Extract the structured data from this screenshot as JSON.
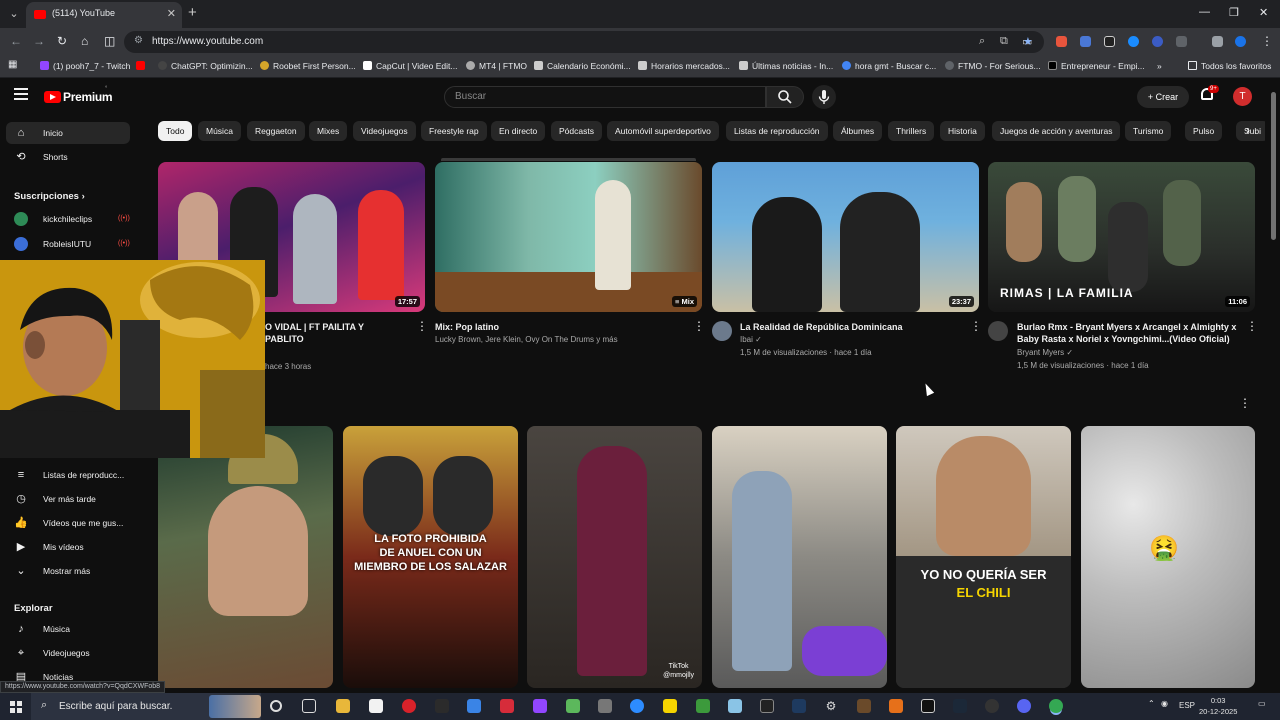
{
  "browser": {
    "tab_title": "(5114) YouTube",
    "url": "https://www.youtube.com",
    "status_url": "https://www.youtube.com/watch?v=QqdCXWFob8",
    "bookmarks": [
      "(1) pooh7_7 - Twitch",
      "ChatGPT: Optimizin...",
      "Roobet First Person...",
      "CapCut | Video Edit...",
      "MT4 | FTMO",
      "Calendario Económi...",
      "Horarios mercados...",
      "Últimas noticias - In...",
      "hora gmt - Buscar c...",
      "FTMO - For Serious...",
      "Entrepreneur - Empi..."
    ],
    "all_bookmarks": "Todos los favoritos"
  },
  "youtube": {
    "logo_text": "Premium",
    "search_placeholder": "Buscar",
    "create_label": "Crear",
    "notif_badge": "9+",
    "avatar_letter": "T",
    "chips": [
      "Todo",
      "Música",
      "Reggaeton",
      "Mixes",
      "Videojuegos",
      "Freestyle rap",
      "En directo",
      "Pódcasts",
      "Automóvil superdeportivo",
      "Listas de reproducción",
      "Álbumes",
      "Thrillers",
      "Historia",
      "Juegos de acción y aventuras",
      "Turismo",
      "Pulso",
      "Subi"
    ],
    "sidebar": {
      "home": "Inicio",
      "shorts": "Shorts",
      "subscriptions_heading": "Suscripciones",
      "subscriptions": [
        "kickchileclips",
        "RobleisIUTU"
      ],
      "you_items": [
        "Listas de reproducc...",
        "Ver más tarde",
        "Vídeos que me gus...",
        "Mis vídeos",
        "Mostrar más"
      ],
      "explore_heading": "Explorar",
      "explore_items": [
        "Música",
        "Videojuegos",
        "Noticias"
      ]
    },
    "videos": [
      {
        "title": "O VIDAL | FT PAILITA Y PABLITO",
        "meta": "hace 3 horas",
        "duration": "17:57",
        "thumb_text": ""
      },
      {
        "title": "Mix: Pop latino",
        "channel": "Lucky Brown, Jere Klein, Ovy On The Drums y más",
        "duration": "Mix"
      },
      {
        "title": "La Realidad de República Dominicana",
        "channel": "Ibai",
        "meta": "1,5 M de visualizaciones · hace 1 día",
        "duration": "23:37"
      },
      {
        "title": "Burlao Rmx - Bryant Myers x Arcangel x Almighty x Baby Rasta x Noriel x Yovngchimi...(Video Oficial)",
        "channel": "Bryant Myers",
        "meta": "1,5 M de visualizaciones · hace 1 día",
        "duration": "11:06",
        "thumb_text": "RIMAS | LA FAMILIA"
      }
    ],
    "shorts_overlays": [
      {
        "lines": [
          "LA FOTO PROHIBIDA",
          "DE ANUEL CON UN",
          "MIEMBRO DE LOS SALAZAR"
        ]
      },
      {
        "lines": [
          "TikTok",
          "@mmojlly"
        ]
      },
      {
        "lines": [
          "YO NO QUERÍA SER",
          "EL CHILI"
        ]
      },
      {
        "lines": [
          "🤮"
        ]
      }
    ]
  },
  "taskbar": {
    "search_label": "Escribe aquí para buscar.",
    "lang": "ESP",
    "time": "0:03",
    "date": "20-12-2025"
  }
}
